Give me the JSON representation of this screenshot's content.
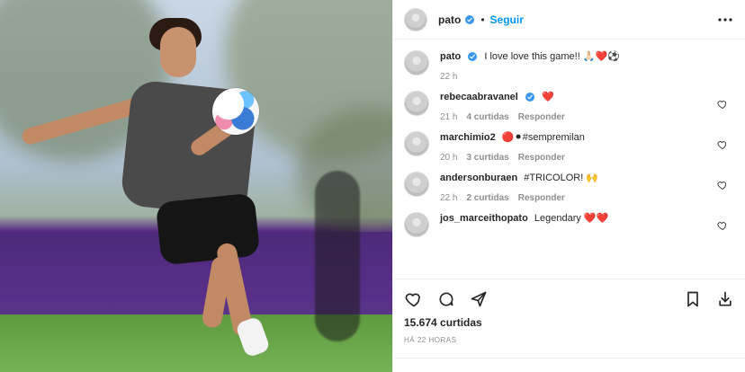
{
  "header": {
    "username": "pato",
    "follow_label": "Seguir",
    "dot": "•"
  },
  "caption": {
    "username": "pato",
    "text": "I love love this game!! 🙏🏻❤️⚽",
    "time": "22 h"
  },
  "comments": [
    {
      "username": "rebecaabravanel",
      "verified": true,
      "text": "❤️",
      "time": "21 h",
      "likes": "4 curtidas",
      "reply_label": "Responder"
    },
    {
      "username": "marchimio2",
      "verified": false,
      "text": "🔴⚫#sempremilan",
      "time": "20 h",
      "likes": "3 curtidas",
      "reply_label": "Responder"
    },
    {
      "username": "andersonburaen",
      "verified": false,
      "text": "#TRICOLOR! 🙌",
      "time": "22 h",
      "likes": "2 curtidas",
      "reply_label": "Responder"
    },
    {
      "username": "jos_marceithopato",
      "verified": false,
      "text": "Legendary ❤️❤️",
      "time": "",
      "likes": "",
      "reply_label": ""
    }
  ],
  "actions": {
    "like_icon": "heart-icon",
    "comment_icon": "comment-icon",
    "share_icon": "send-icon",
    "save_icon": "bookmark-icon",
    "export_icon": "share-export-icon"
  },
  "post": {
    "likes_label": "15.674 curtidas",
    "time_label": "HÁ 22 HORAS"
  },
  "colors": {
    "accent": "#0095f6",
    "verified": "#3897f0",
    "heart_red": "#ed4956",
    "muted": "#8e8e8e",
    "border": "#efefef"
  }
}
